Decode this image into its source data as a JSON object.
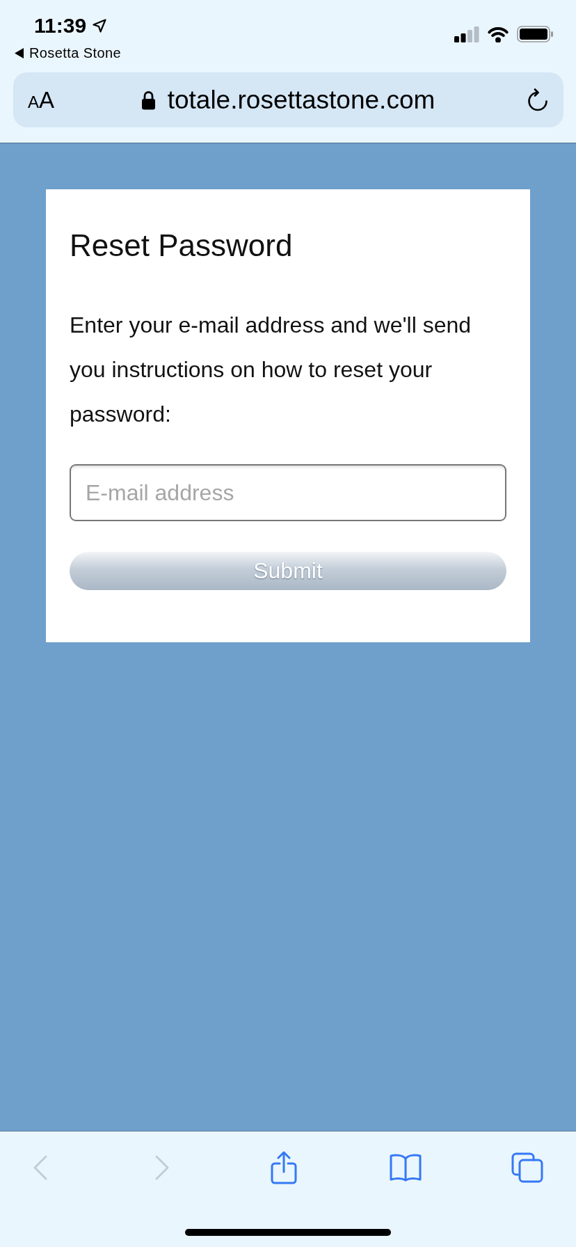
{
  "status_bar": {
    "time": "11:39",
    "back_to_app": "Rosetta Stone"
  },
  "address_bar": {
    "text_size_button": "AA",
    "url": "totale.rosettastone.com"
  },
  "reset_form": {
    "title": "Reset Password",
    "instructions": "Enter your e-mail address and we'll send you instructions on how to reset your password:",
    "email_field": {
      "placeholder": "E-mail address"
    },
    "submit_button": {
      "label": "Submit",
      "disabled": true
    }
  },
  "toolbar": {
    "buttons": [
      {
        "kind": "back",
        "disabled": true
      },
      {
        "kind": "forward",
        "disabled": true
      },
      {
        "kind": "share",
        "disabled": false
      },
      {
        "kind": "bookmarks",
        "disabled": false
      },
      {
        "kind": "tabs",
        "disabled": false
      }
    ]
  }
}
